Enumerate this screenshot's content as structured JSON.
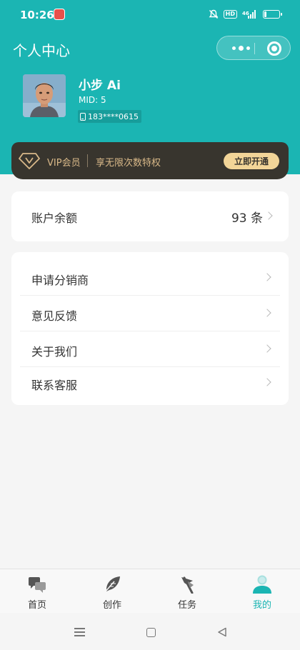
{
  "status_bar": {
    "time": "10:26",
    "signal_text": "⁴⁶ᴵ",
    "hd": "HD"
  },
  "header": {
    "title": "个人中心"
  },
  "profile": {
    "name": "小步 Ai",
    "mid": "MID: 5",
    "phone": "183****0615"
  },
  "vip": {
    "label": "VIP会员",
    "description": "享无限次数特权",
    "button": "立即开通"
  },
  "balance": {
    "label": "账户余额",
    "value": "93 条"
  },
  "menu": [
    {
      "label": "申请分销商"
    },
    {
      "label": "意见反馈"
    },
    {
      "label": "关于我们"
    },
    {
      "label": "联系客服"
    }
  ],
  "tabbar": [
    {
      "label": "首页",
      "icon": "chat-bubbles-icon"
    },
    {
      "label": "创作",
      "icon": "feather-icon"
    },
    {
      "label": "任务",
      "icon": "flag-icon"
    },
    {
      "label": "我的",
      "icon": "user-icon",
      "active": true
    }
  ],
  "colors": {
    "accent": "#1bb5b3",
    "vip_bg": "#38352e",
    "vip_text": "#d9b989",
    "vip_button": "#f2d598"
  }
}
